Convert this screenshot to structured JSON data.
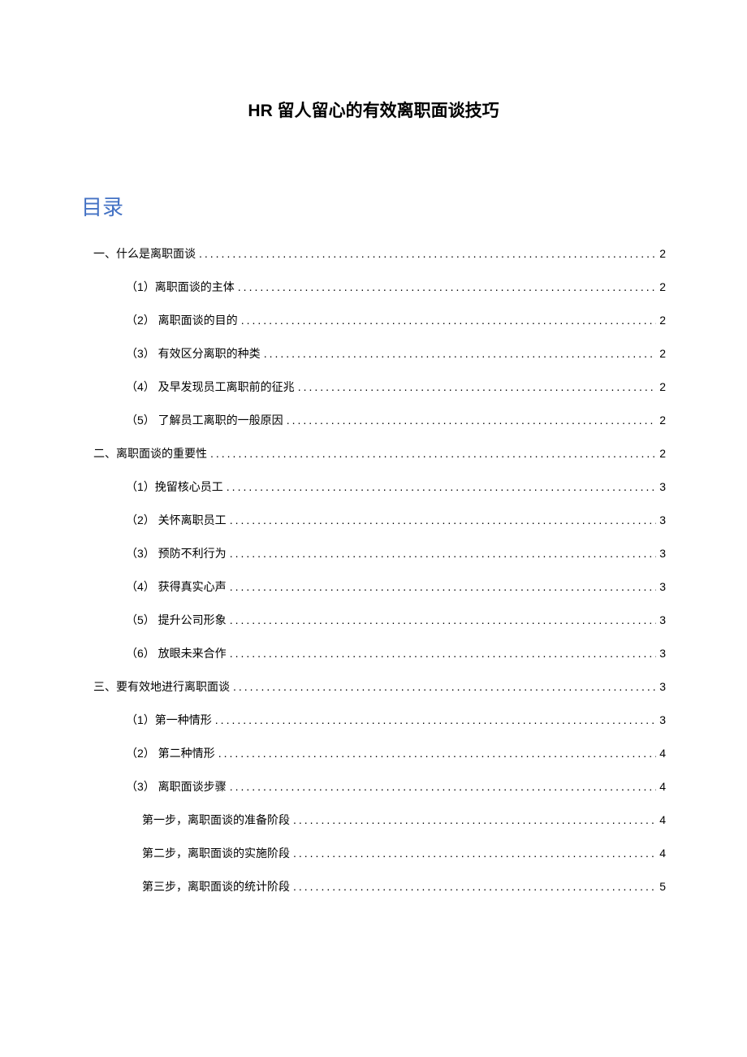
{
  "title": "HR 留人留心的有效离职面谈技巧",
  "toc_heading": "目录",
  "toc": [
    {
      "level": 1,
      "text": "一、什么是离职面谈",
      "page": "2"
    },
    {
      "level": 2,
      "text": "（1）离职面谈的主体",
      "page": "2"
    },
    {
      "level": 2,
      "text": "（2） 离职面谈的目的",
      "page": "2"
    },
    {
      "level": 2,
      "text": "（3） 有效区分离职的种类",
      "page": "2"
    },
    {
      "level": 2,
      "text": "（4） 及早发现员工离职前的征兆",
      "page": "2"
    },
    {
      "level": 2,
      "text": "（5） 了解员工离职的一般原因",
      "page": "2"
    },
    {
      "level": 1,
      "text": "二、离职面谈的重要性",
      "page": "2"
    },
    {
      "level": 2,
      "text": "（1）挽留核心员工",
      "page": "3"
    },
    {
      "level": 2,
      "text": "（2） 关怀离职员工",
      "page": "3"
    },
    {
      "level": 2,
      "text": "（3） 预防不利行为",
      "page": "3"
    },
    {
      "level": 2,
      "text": "（4） 获得真实心声",
      "page": "3"
    },
    {
      "level": 2,
      "text": "（5） 提升公司形象",
      "page": "3"
    },
    {
      "level": 2,
      "text": "（6） 放眼未来合作",
      "page": "3"
    },
    {
      "level": 1,
      "text": "三、要有效地进行离职面谈",
      "page": "3"
    },
    {
      "level": 2,
      "text": "（1）第一种情形",
      "page": "3"
    },
    {
      "level": 2,
      "text": "（2） 第二种情形",
      "page": "4"
    },
    {
      "level": 2,
      "text": "（3） 离职面谈步骤",
      "page": "4"
    },
    {
      "level": 3,
      "text": "第一步，离职面谈的准备阶段",
      "page": "4"
    },
    {
      "level": 3,
      "text": "第二步，离职面谈的实施阶段",
      "page": "4"
    },
    {
      "level": 3,
      "text": "第三步，离职面谈的统计阶段",
      "page": "5"
    }
  ]
}
